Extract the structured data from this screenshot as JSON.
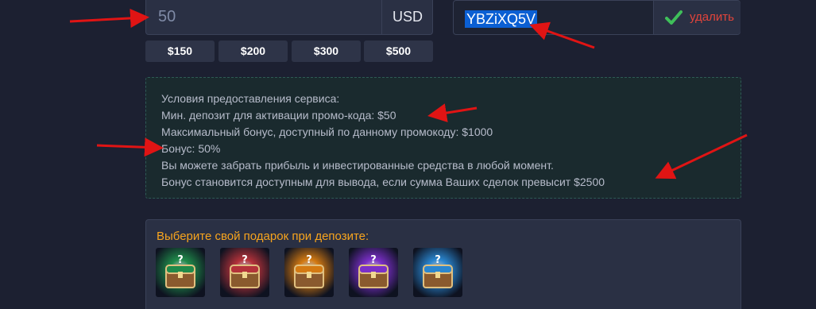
{
  "deposit": {
    "amount_value": "50",
    "currency": "USD",
    "presets": [
      "$150",
      "$200",
      "$300",
      "$500"
    ]
  },
  "promo": {
    "code": "YBZiXQ5V",
    "remove_label": "удалить"
  },
  "terms": {
    "lines": [
      "Условия предоставления сервиса:",
      "Мин. депозит для активации промо-кода: $50",
      "Максимальный бонус, доступный по данному промокоду: $1000",
      "Бонус: 50%",
      "Вы можете забрать прибыль и инвестированные средства в любой момент.",
      "Бонус становится доступным для вывода, если сумма Ваших сделок превысит $2500"
    ]
  },
  "gifts": {
    "title": "Выберите свой подарок при депозите:",
    "chests": [
      {
        "icon": "green-chest-icon",
        "color": "#1f8a4a"
      },
      {
        "icon": "red-chest-icon",
        "color": "#b4323a"
      },
      {
        "icon": "orange-chest-icon",
        "color": "#d47a12"
      },
      {
        "icon": "purple-chest-icon",
        "color": "#7a2fc8"
      },
      {
        "icon": "blue-chest-icon",
        "color": "#2a86d0"
      }
    ]
  },
  "colors": {
    "background": "#1c2031",
    "accent_orange": "#f7a41e",
    "remove_red": "#e2443b",
    "check_green": "#3fbf5a",
    "annotation_arrow": "#e01414"
  }
}
